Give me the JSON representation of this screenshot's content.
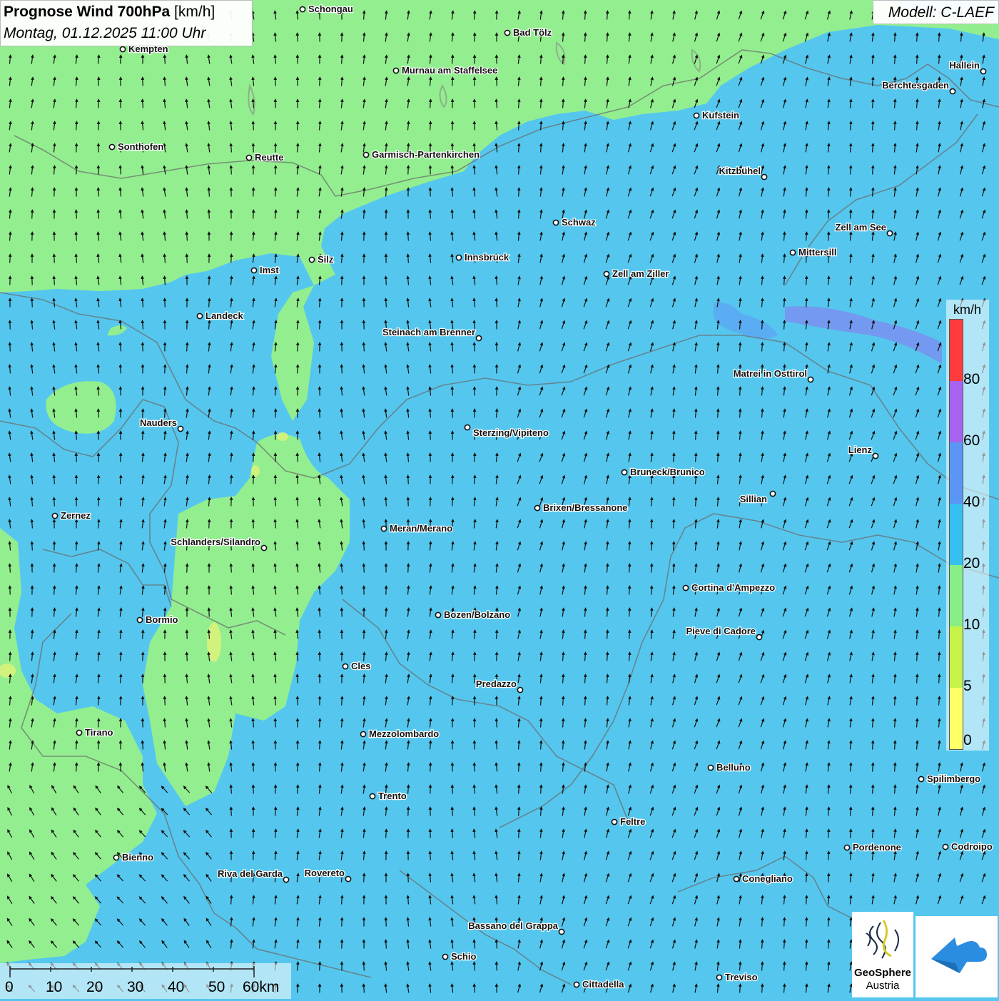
{
  "title": {
    "bold": "Prognose Wind 700hPa",
    "unit": "[km/h]",
    "date": "Montag, 01.12.2025 11:00 Uhr"
  },
  "model": "Modell: C-LAEF",
  "legend": {
    "unit": "km/h",
    "ticks": [
      "80",
      "60",
      "40",
      "20",
      "10",
      "5",
      "0"
    ],
    "colors": [
      "#ff3b3b",
      "#a862f0",
      "#5c96f4",
      "#35c0f0",
      "#88ee88",
      "#c7f24a",
      "#ffff66"
    ]
  },
  "scale_bar": {
    "labels": [
      "0",
      "10",
      "20",
      "30",
      "40",
      "50",
      "60km"
    ]
  },
  "logos": {
    "geosphere_name": "GeoSphere",
    "geosphere_sub": "Austria",
    "geosphere_icon": "geosphere-logo-icon",
    "app_icon": "cloud-arrow-logo-icon"
  },
  "colors": {
    "calm_green": "#93ee8f",
    "light_blue": "#55c7ee",
    "mid_blue": "#5ba6f2",
    "purple_band": "#7b8ff0",
    "yellow_spot": "#d8f27a"
  },
  "cities": [
    {
      "name": "Schongau"
    },
    {
      "name": "Bad Tölz"
    },
    {
      "name": "Kempten"
    },
    {
      "name": "Murnau am Staffelsee"
    },
    {
      "name": "Hallein"
    },
    {
      "name": "Berchtesgaden"
    },
    {
      "name": "Kufstein"
    },
    {
      "name": "Sonthofen"
    },
    {
      "name": "Reutte"
    },
    {
      "name": "Garmisch-Partenkirchen"
    },
    {
      "name": "Kitzbühel"
    },
    {
      "name": "Schwaz"
    },
    {
      "name": "Zell am See"
    },
    {
      "name": "Mittersill"
    },
    {
      "name": "Innsbruck"
    },
    {
      "name": "Silz"
    },
    {
      "name": "Imst"
    },
    {
      "name": "Zell am Ziller"
    },
    {
      "name": "Landeck"
    },
    {
      "name": "Steinach am Brenner"
    },
    {
      "name": "Matrei in Osttirol"
    },
    {
      "name": "Nauders"
    },
    {
      "name": "Sterzing/Vipiteno"
    },
    {
      "name": "Lienz"
    },
    {
      "name": "Bruneck/Brunico"
    },
    {
      "name": "Sillian"
    },
    {
      "name": "Zernez"
    },
    {
      "name": "Brixen/Bressanone"
    },
    {
      "name": "Meran/Merano"
    },
    {
      "name": "Schlanders/Silandro"
    },
    {
      "name": "Cortina d'Ampezzo"
    },
    {
      "name": "Bozen/Bolzano"
    },
    {
      "name": "Bormio"
    },
    {
      "name": "Pieve di Cadore"
    },
    {
      "name": "Cles"
    },
    {
      "name": "Predazzo"
    },
    {
      "name": "Tirano"
    },
    {
      "name": "Mezzolombardo"
    },
    {
      "name": "Belluno"
    },
    {
      "name": "Spilimbergo"
    },
    {
      "name": "Trento"
    },
    {
      "name": "Feltre"
    },
    {
      "name": "Pordenone"
    },
    {
      "name": "Codroipo"
    },
    {
      "name": "Bienno"
    },
    {
      "name": "Riva del Garda"
    },
    {
      "name": "Rovereto"
    },
    {
      "name": "Conegliano"
    },
    {
      "name": "Bassano del Grappa"
    },
    {
      "name": "Schio"
    },
    {
      "name": "Treviso"
    },
    {
      "name": "Cittadella"
    }
  ]
}
